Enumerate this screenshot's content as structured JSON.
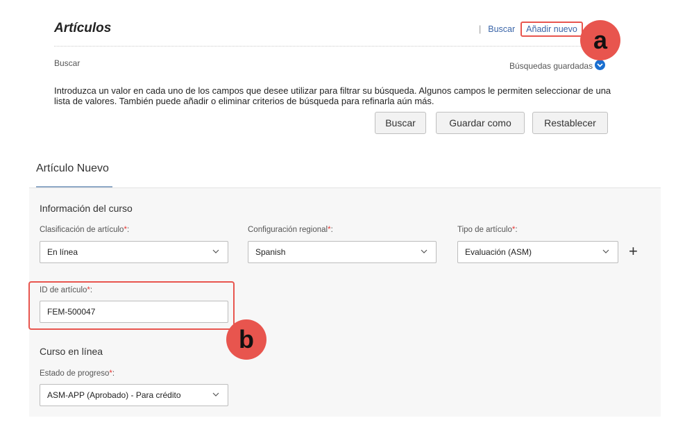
{
  "header": {
    "title": "Artículos",
    "links": {
      "search": "Buscar",
      "add_new": "Añadir nuevo"
    }
  },
  "search": {
    "label": "Buscar",
    "saved_searches": "Búsquedas guardadas",
    "instructions": "Introduzca un valor en cada uno de los campos que desee utilizar para filtrar su búsqueda. Algunos campos le permiten seleccionar de una lista de valores. También puede añadir o eliminar criterios de búsqueda para refinarla aún más.",
    "buttons": {
      "search": "Buscar",
      "save_as": "Guardar como",
      "reset": "Restablecer"
    }
  },
  "form": {
    "title": "Artículo Nuevo",
    "course_section": "Información del curso",
    "classification": {
      "label": "Clasificación de artículo",
      "value": "En línea"
    },
    "locale": {
      "label": "Configuración regional",
      "value": "Spanish"
    },
    "item_type": {
      "label": "Tipo de artículo",
      "value": "Evaluación (ASM)"
    },
    "item_id": {
      "label": "ID de artículo",
      "value": "FEM-500047"
    },
    "online_section": "Curso en línea",
    "progress_state": {
      "label": "Estado de progreso",
      "value": "ASM-APP (Aprobado) - Para crédito"
    },
    "required_mark": "*",
    "label_suffix": ":"
  },
  "annotations": {
    "a": "a",
    "b": "b"
  },
  "colors": {
    "annotation": "#e8554e",
    "link": "#3a65a8",
    "required": "#e53935"
  }
}
